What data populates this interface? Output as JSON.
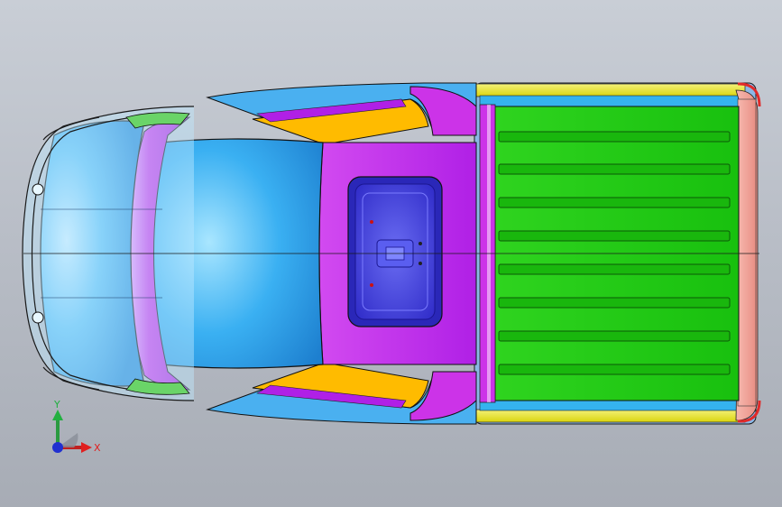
{
  "viewport": {
    "background_top": "#c9ced6",
    "background_bottom": "#a7acb5"
  },
  "model": {
    "parts": [
      {
        "name": "front-bumper-frame",
        "color": "#9fd6f0"
      },
      {
        "name": "hood",
        "color": "#4ab0f0"
      },
      {
        "name": "windshield-frame",
        "color": "#cc33e8"
      },
      {
        "name": "cab-roof",
        "color": "#36a8ec"
      },
      {
        "name": "rear-cab-panel",
        "color": "#bb22ee"
      },
      {
        "name": "sunroof-tray",
        "color": "#3c34d8"
      },
      {
        "name": "door-panel",
        "color": "#ffbb00"
      },
      {
        "name": "cargo-bed-floor",
        "color": "#22cc11"
      },
      {
        "name": "bed-side-rail",
        "color": "#e6e61a"
      },
      {
        "name": "tailgate",
        "color": "#f0a49a"
      },
      {
        "name": "fender-trim",
        "color": "#6ad468"
      }
    ]
  },
  "triad": {
    "x_label": "X",
    "y_label": "Y",
    "x_color": "#e02020",
    "y_color": "#20b040",
    "origin_color": "#2030d0"
  }
}
